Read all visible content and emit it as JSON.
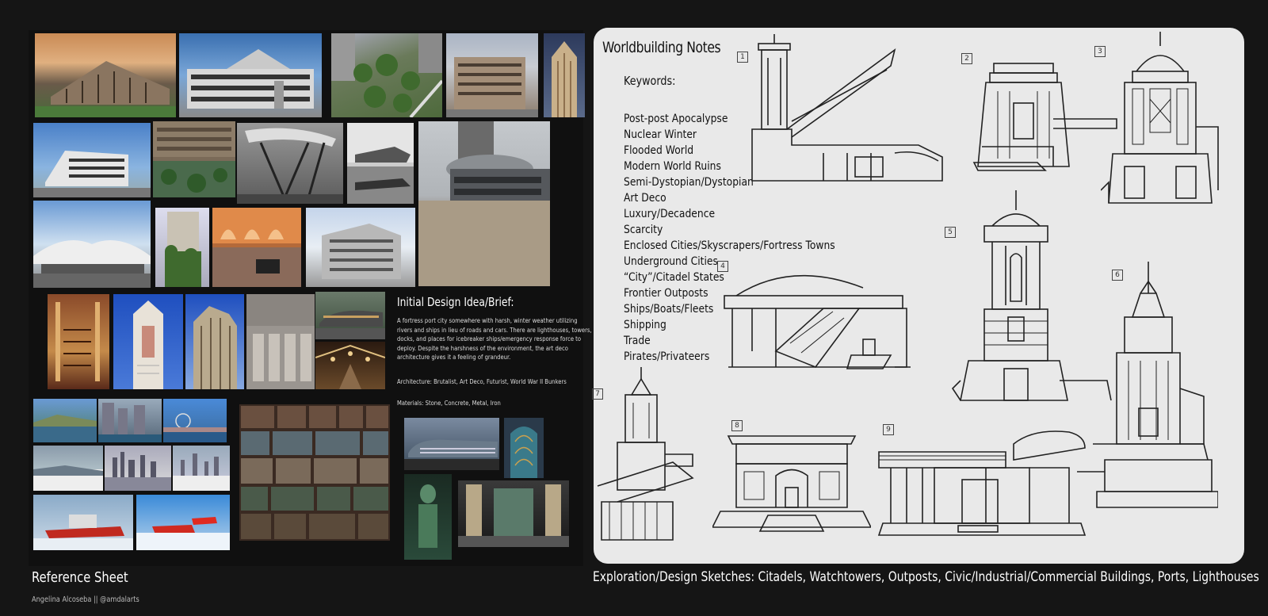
{
  "notes": {
    "title": "Worldbuilding Notes",
    "keywords_heading": "Keywords:",
    "keywords": [
      "Post-post Apocalypse",
      "Nuclear Winter",
      "Flooded World",
      "Modern World Ruins",
      "Semi-Dystopian/Dystopian",
      "Art Deco",
      "Luxury/Decadence",
      "Scarcity",
      "Enclosed Cities/Skyscrapers/Fortress Towns",
      "Underground Cities",
      "“City”/Citadel States",
      "Frontier Outposts",
      "Ships/Boats/Fleets",
      "Shipping",
      "Trade",
      "Pirates/Privateers"
    ]
  },
  "brief": {
    "title": "Initial Design Idea/Brief:",
    "text": "A fortress port city somewhere with harsh, winter weather utilizing rivers and ships in lieu of roads and cars. There are lighthouses, towers, docks, and places for icebreaker ships/emergency response force to deploy. Despite the harshness of the environment, the art deco architecture gives it a feeling of grandeur.",
    "architecture": "Architecture: Brutalist, Art Deco, Futurist, World War II Bunkers",
    "materials": "Materials: Stone, Concrete, Metal, Iron"
  },
  "sketch_numbers": [
    "1",
    "2",
    "3",
    "4",
    "5",
    "6",
    "7",
    "8",
    "9"
  ],
  "footer": {
    "left_title": "Reference Sheet",
    "credit": "Angelina Alcoseba || @amdalarts",
    "right_title": "Exploration/Design Sketches: Citadels, Watchtowers, Outposts, Civic/Industrial/Commercial Buildings, Ports, Lighthouses"
  },
  "colors": {
    "background": "#151515",
    "sketch_panel": "#e9e9e9",
    "text_light": "#ffffff"
  }
}
